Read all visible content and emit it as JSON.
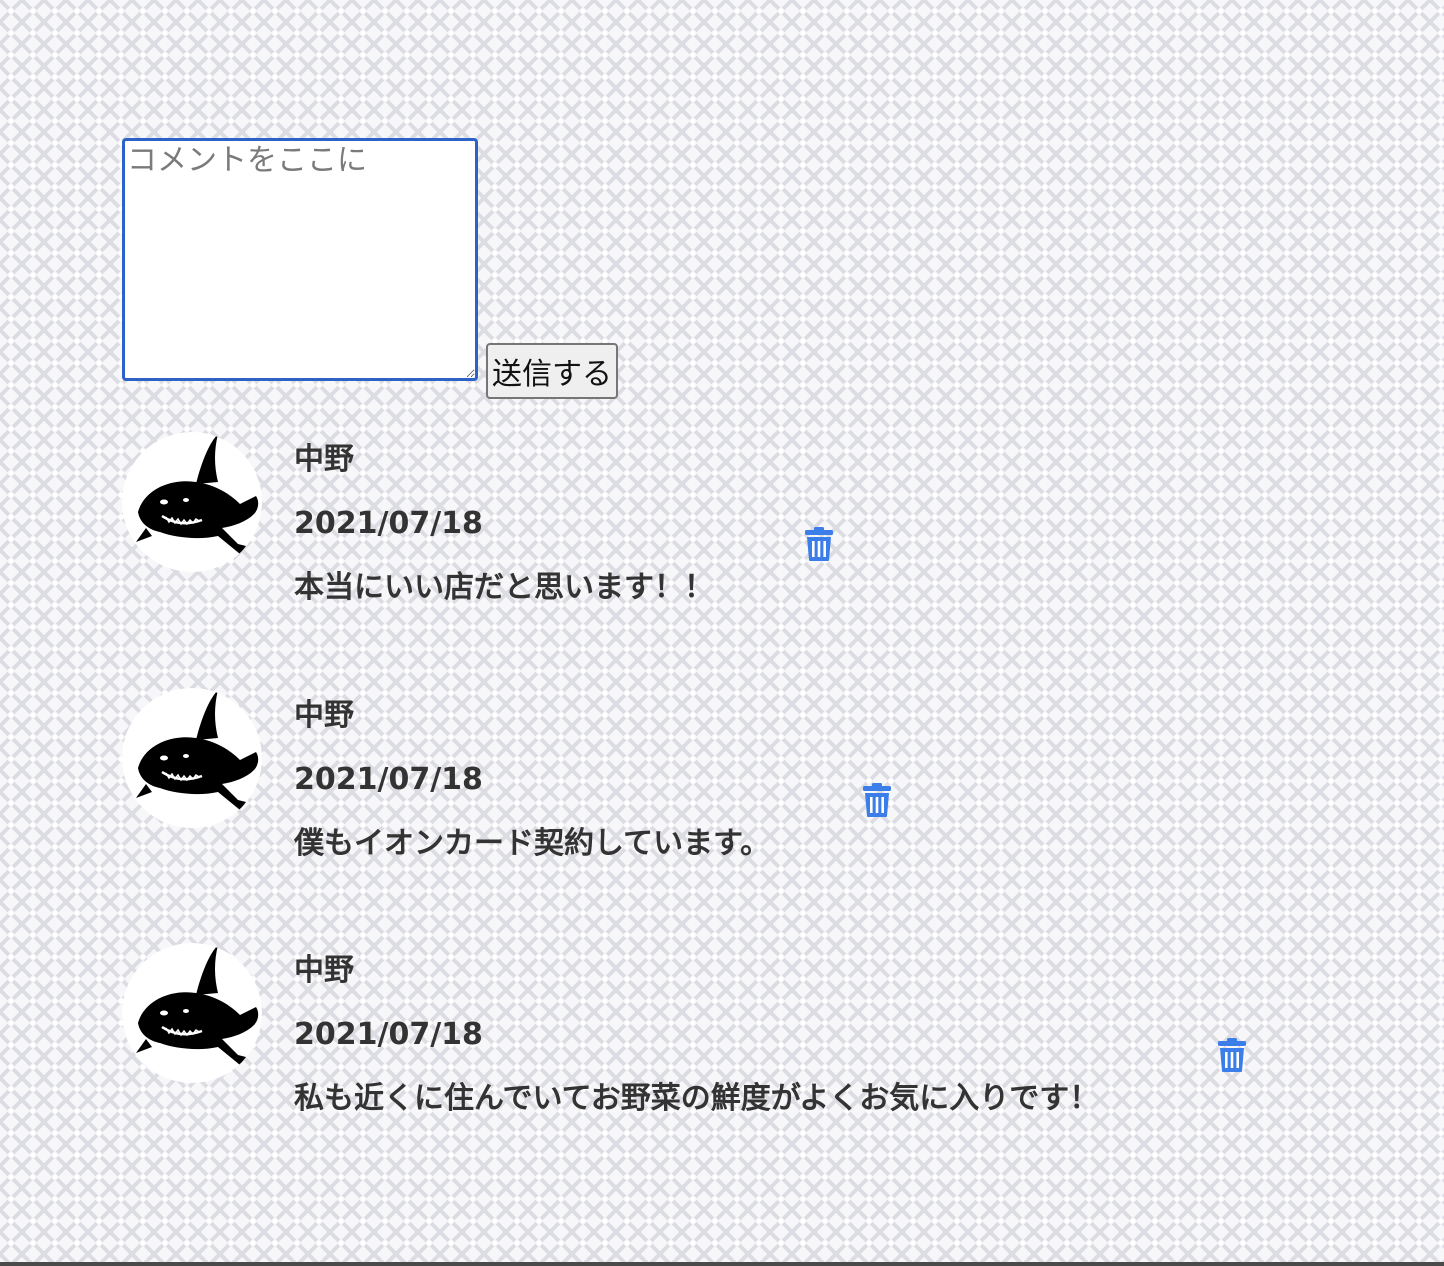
{
  "form": {
    "textarea_placeholder": "コメントをここに",
    "textarea_value": "",
    "submit_label": "送信する"
  },
  "comments": [
    {
      "author": "中野",
      "date": "2021/07/18",
      "body": "本当にいい店だと思います！！"
    },
    {
      "author": "中野",
      "date": "2021/07/18",
      "body": "僕もイオンカード契約しています。"
    },
    {
      "author": "中野",
      "date": "2021/07/18",
      "body": "私も近くに住んでいてお野菜の鮮度がよくお気に入りです！"
    }
  ],
  "icons": {
    "avatar": "shark-avatar-icon",
    "delete": "trash-icon"
  },
  "colors": {
    "accent": "#3b7de9",
    "text": "#333333",
    "textarea_border": "#2d63c8"
  }
}
